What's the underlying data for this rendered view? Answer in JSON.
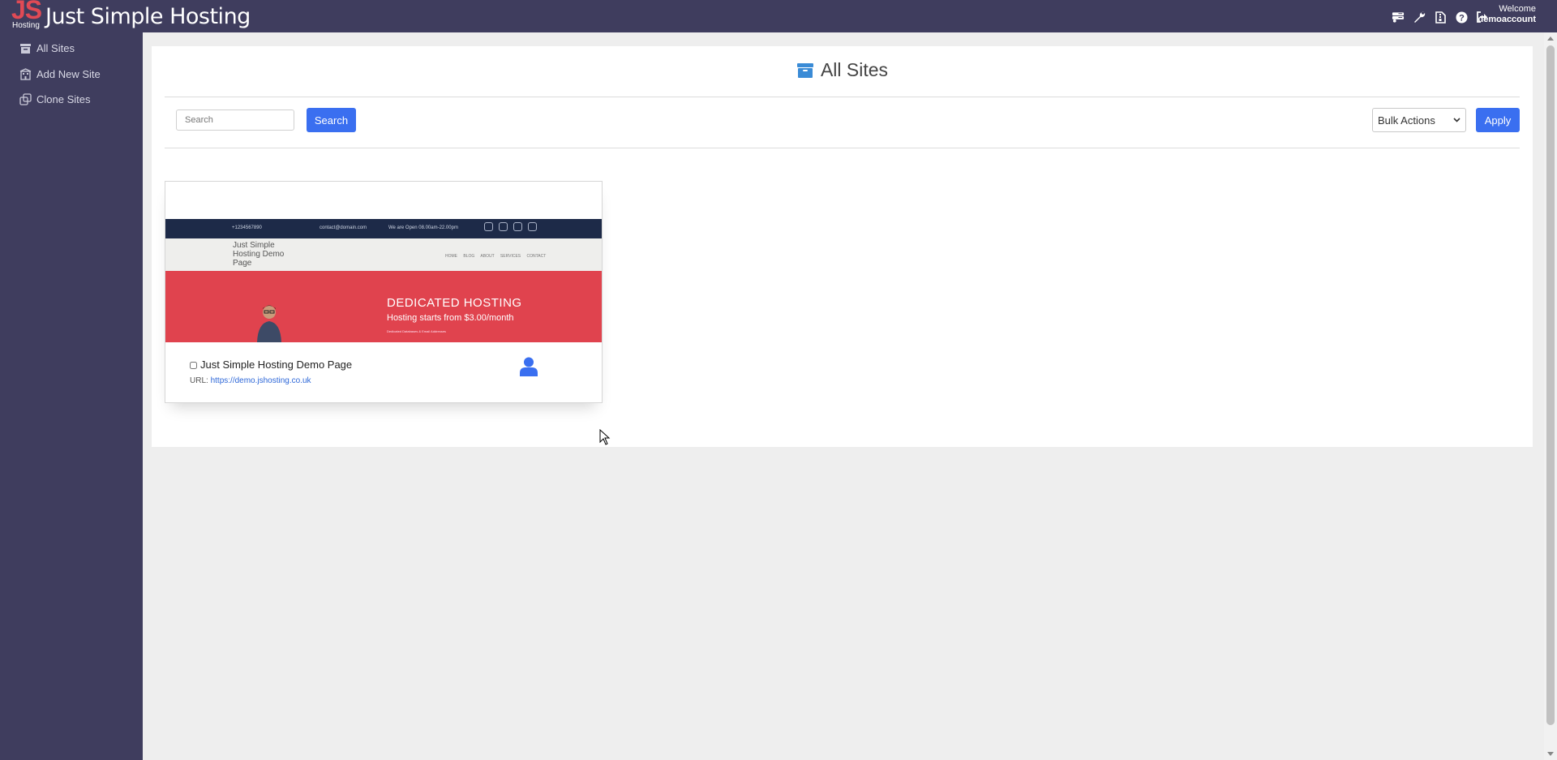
{
  "header": {
    "logo_text": "JS",
    "logo_subtext": "Hosting",
    "brand": "Just Simple Hosting",
    "welcome_label": "Welcome",
    "username": "demoaccount",
    "icons": [
      "servers-icon",
      "wrench-icon",
      "file-archive-icon",
      "help-icon",
      "logout-icon"
    ]
  },
  "sidebar": {
    "items": [
      {
        "label": "All Sites",
        "icon": "archive-icon"
      },
      {
        "label": "Add New Site",
        "icon": "building-icon"
      },
      {
        "label": "Clone Sites",
        "icon": "clone-icon"
      }
    ]
  },
  "main": {
    "title": "All Sites",
    "search": {
      "placeholder": "Search",
      "button_label": "Search"
    },
    "bulk": {
      "selected": "Bulk Actions",
      "apply_label": "Apply"
    }
  },
  "sites": [
    {
      "name": "Just Simple Hosting Demo Page",
      "url_label": "URL:",
      "url": "https://demo.jshosting.co.uk",
      "checked": false,
      "thumbnail": {
        "phone": "+1234567890",
        "email": "contact@domain.com",
        "hours": "We are Open 08.00am-22.00pm",
        "site_name": "Just Simple Hosting Demo Page",
        "nav_links": "HOME BLOG ABOUT SERVICES CONTACT",
        "headline": "DEDICATED HOSTING",
        "subheadline": "Hosting starts from $3.00/month",
        "tagline": "Dedicated Databases & Email Addresses"
      }
    }
  ],
  "colors": {
    "nav_bg": "#3f3d5e",
    "accent": "#3a6ff0",
    "hero_red": "#e0434e",
    "logo_red": "#e04a55"
  }
}
